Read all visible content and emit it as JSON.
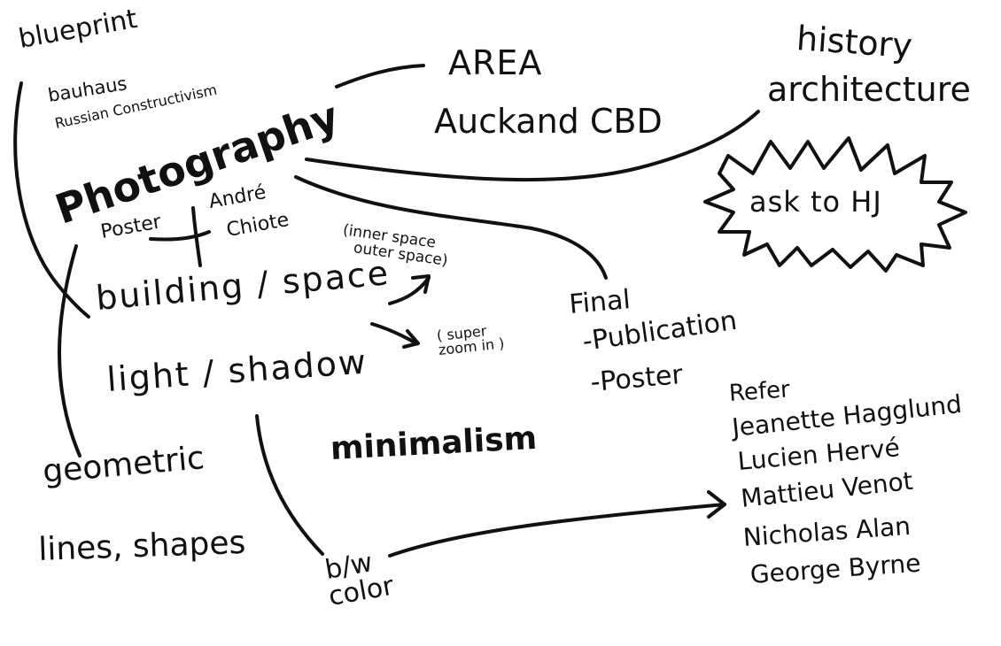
{
  "notes": {
    "blueprint": "blueprint",
    "bauhaus": "bauhaus",
    "russian_constructivism": "Russian Constructivism",
    "photography": "Photography",
    "poster": "Poster",
    "andre": "André",
    "chiote": "Chiote",
    "area": "AREA",
    "auckland_cbd": "Auckand CBD",
    "history": "history",
    "architecture": "architecture",
    "ask_to_hj": "ask to HJ",
    "inner_space": "(inner space",
    "outer_space": "outer space)",
    "building_space": "building / space",
    "super": "( super",
    "zoom_in": "zoom in )",
    "light_shadow": "light / shadow",
    "final": "Final",
    "publication": "-Publication",
    "poster_item": "-Poster",
    "minimalism": "minimalism",
    "geometric": "geometric",
    "lines_shapes": "lines, shapes",
    "bw": "b/w",
    "color": "color",
    "refer": "Refer",
    "references": [
      "Jeanette Hagglund",
      "Lucien Hervé",
      "Mattieu Venot",
      "Nicholas Alan",
      "George Byrne"
    ]
  }
}
